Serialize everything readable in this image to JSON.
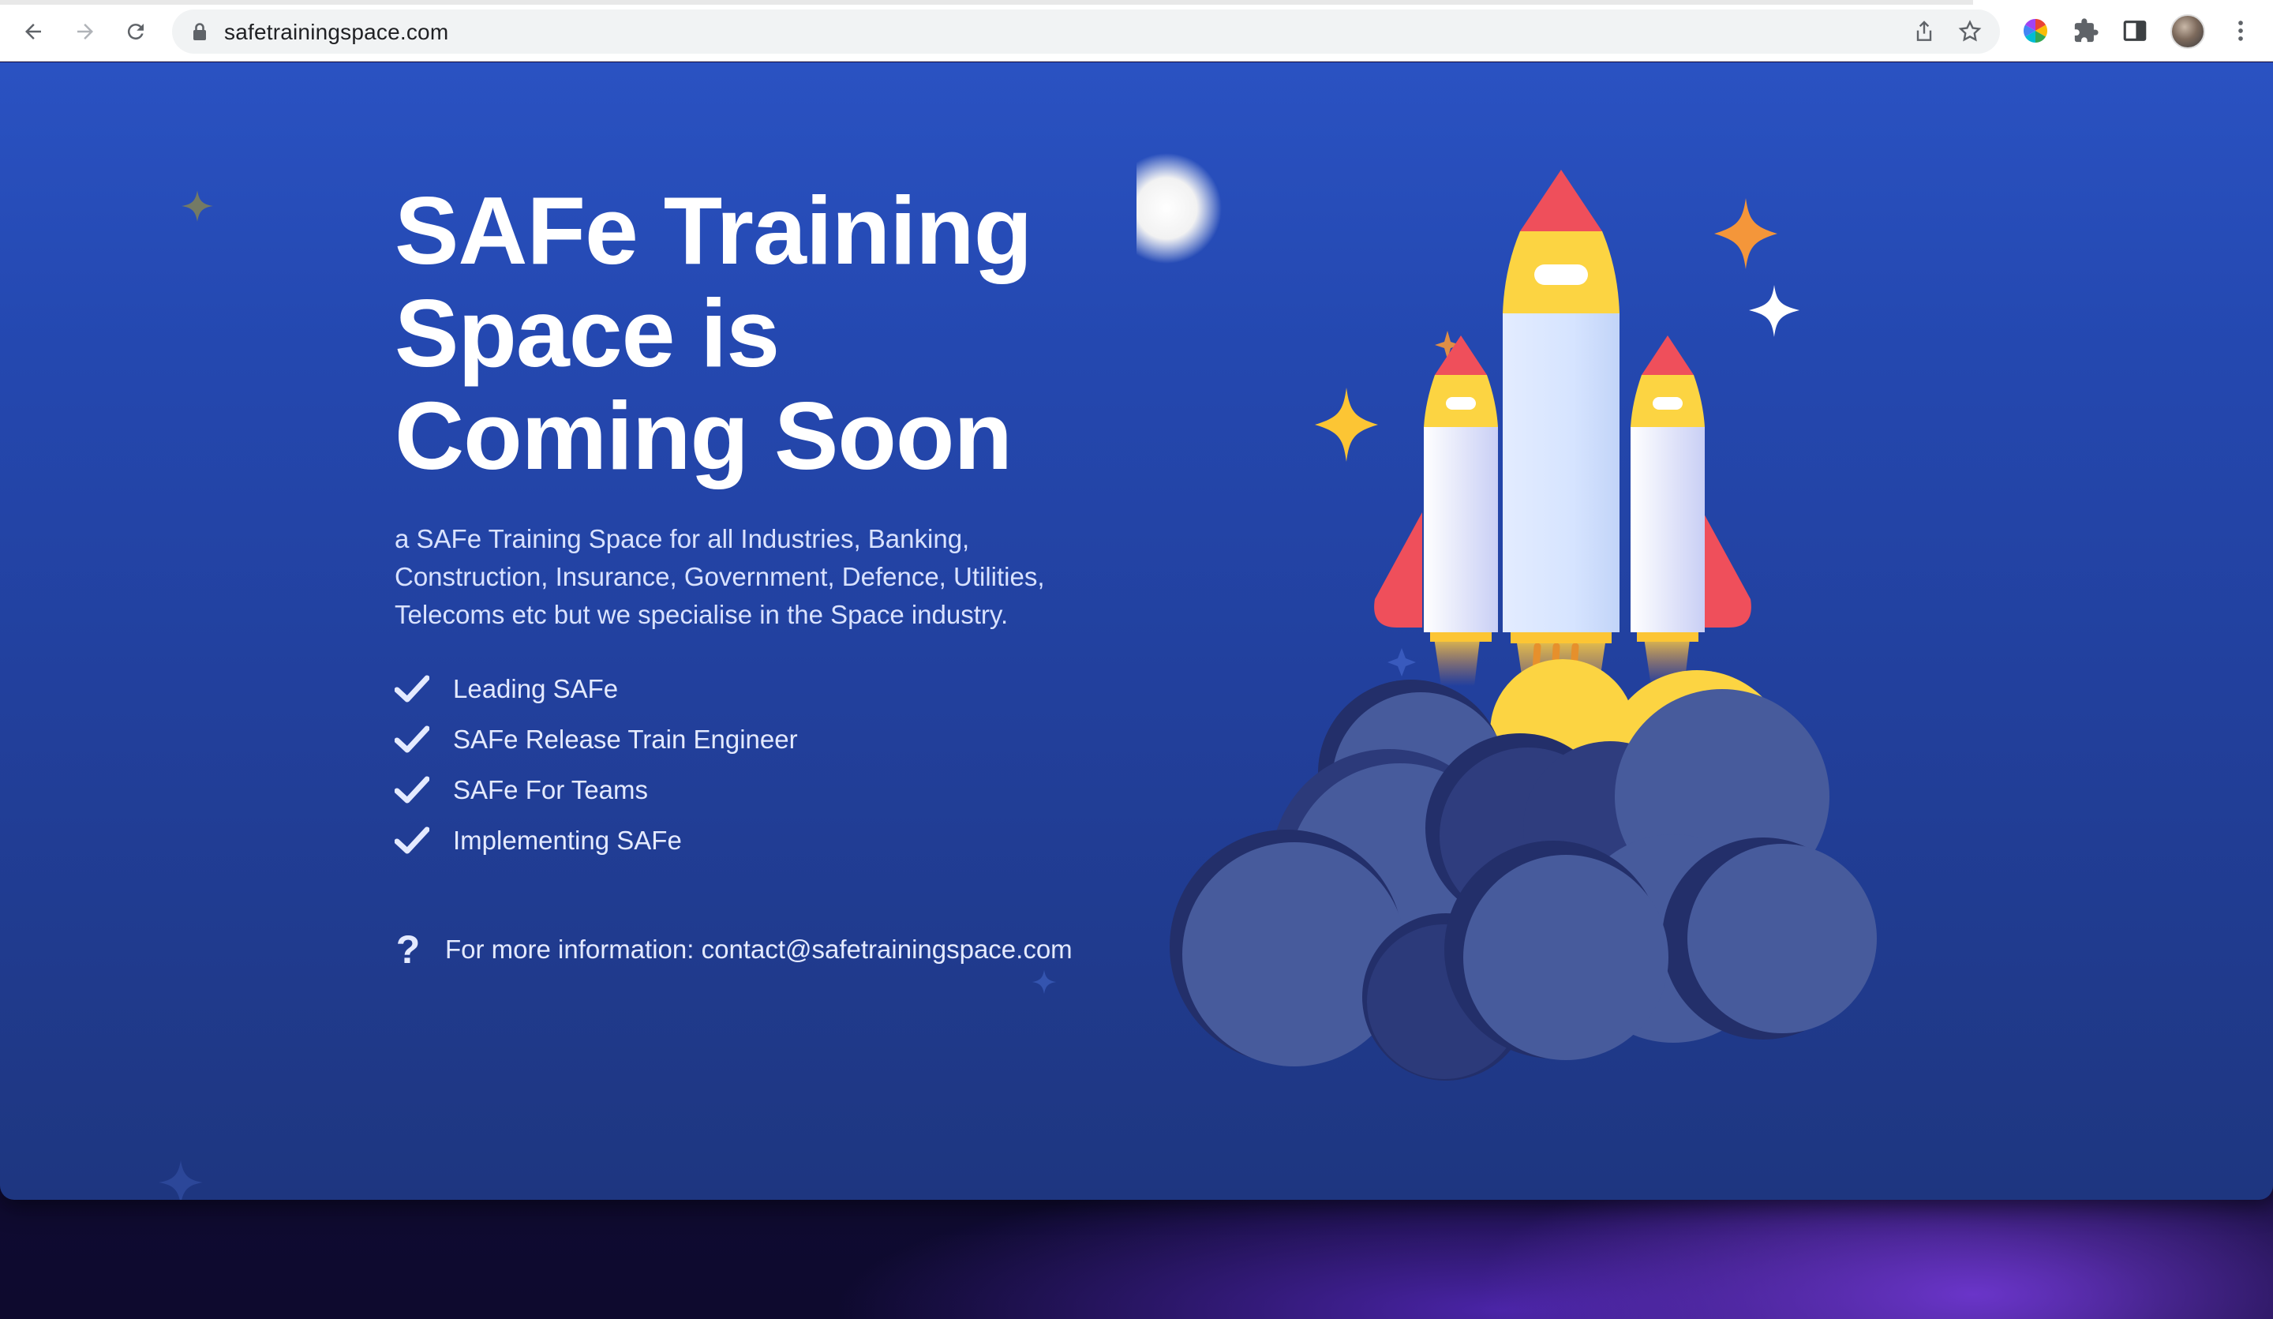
{
  "browser": {
    "url": "safetrainingspace.com",
    "icons": [
      "back-arrow-icon",
      "forward-arrow-icon",
      "reload-icon",
      "lock-icon",
      "share-icon",
      "bookmark-star-icon",
      "color-wheel-extension-icon",
      "puzzle-extensions-icon",
      "side-panel-icon",
      "profile-avatar",
      "more-menu-icon"
    ]
  },
  "hero": {
    "title_line1": "SAFe Training",
    "title_line2": "Space is",
    "title_line3": "Coming Soon",
    "description_line1": "a SAFe Training Space for all Industries, Banking,",
    "description_line2": "Construction, Insurance, Government, Defence, Utilities,",
    "description_line3": "Telecoms etc but we specialise in the Space industry."
  },
  "features": [
    {
      "label": "Leading SAFe"
    },
    {
      "label": "SAFe Release Train Engineer"
    },
    {
      "label": "SAFe For Teams"
    },
    {
      "label": "Implementing SAFe"
    }
  ],
  "contact": {
    "text": "For more information: contact@safetrainingspace.com"
  },
  "colors": {
    "page_top": "#2a52c2",
    "page_bottom": "#1e3680",
    "rocket_red": "#ef4f5b",
    "rocket_yellow": "#fcd442",
    "cloud": "#475b9c",
    "star_orange": "#f4963a",
    "star_yellow": "#fcc534"
  }
}
